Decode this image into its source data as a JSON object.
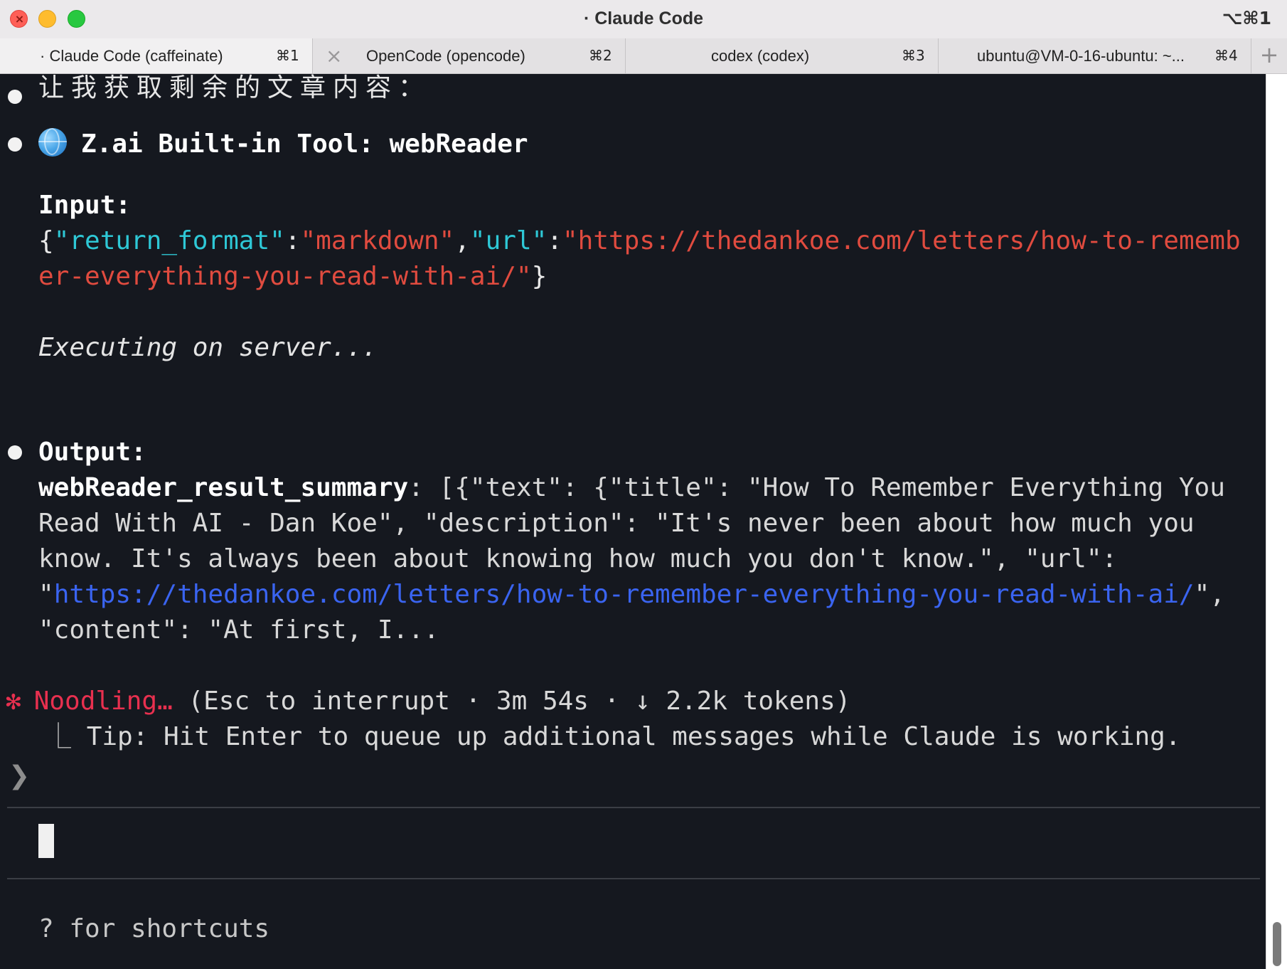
{
  "window": {
    "title": "· Claude Code",
    "shortcut": "⌥⌘1",
    "colors": {
      "close": "#fe5f57",
      "minimize": "#febc2e",
      "maximize": "#28c840"
    }
  },
  "tabs": [
    {
      "label": "· Claude Code (caffeinate)",
      "key": "⌘1",
      "active": true
    },
    {
      "label": "OpenCode (opencode)",
      "key": "⌘2",
      "active": false
    },
    {
      "label": "codex (codex)",
      "key": "⌘3",
      "active": false
    },
    {
      "label": "ubuntu@VM-0-16-ubuntu: ~...",
      "key": "⌘4",
      "active": false
    }
  ],
  "icons": {
    "close_tab": "×",
    "new_tab": "+"
  },
  "terminal": {
    "line1": "让我获取剩余的文章内容：",
    "tool_title": "Z.ai Built-in Tool: webReader",
    "input_label": "Input:",
    "input_json": {
      "open": "{",
      "k1": "\"return_format\"",
      "colon1": ":",
      "v1": "\"markdown\"",
      "comma": ",",
      "k2": "\"url\"",
      "colon2": ":",
      "v2_part1": "\"https://thedankoe.com/letters/how-to-rememb",
      "v2_part2": "er-everything-you-read-with-ai/\"",
      "close": "}"
    },
    "executing": "Executing on server...",
    "output_label": "Output:",
    "summary_key": "webReader_result_summary",
    "summary_line1": ": [{\"text\": {\"title\": \"How To Remember Everything You",
    "summary_line2": "Read With AI - Dan Koe\", \"description\": \"It's never been about how much you",
    "summary_line3": "know. It's always been about knowing how much you don't know.\", \"url\":",
    "summary_line4_q1": "\"",
    "summary_line4_url": "https://thedankoe.com/letters/how-to-remember-everything-you-read-with-ai/",
    "summary_line4_q2": "\",",
    "summary_line5": "\"content\": \"At first, I...",
    "status_star": "✻",
    "status_word": "Noodling…",
    "status_detail": " (Esc to interrupt · 3m 54s · ↓ 2.2k tokens)",
    "tip_corner": "⎿",
    "tip": "  Tip: Hit Enter to queue up additional messages while Claude is working.",
    "prompt_caret": "❯",
    "footer": "? for shortcuts"
  }
}
